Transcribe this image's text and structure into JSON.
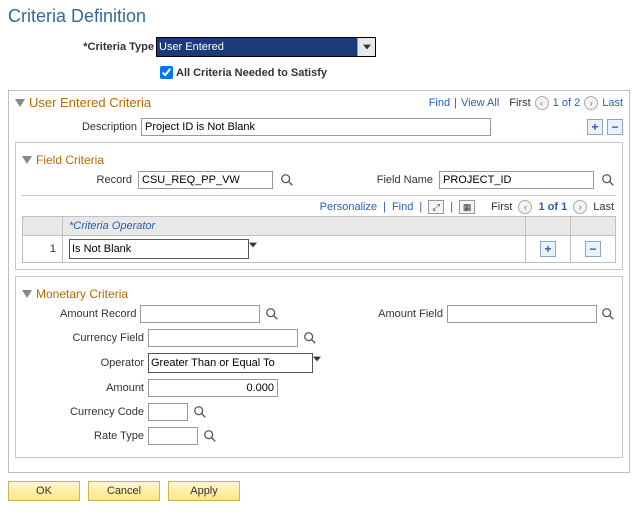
{
  "page_title": "Criteria Definition",
  "criteria_type": {
    "label": "*Criteria Type",
    "value": "User Entered"
  },
  "all_criteria_checkbox": {
    "label": "All Criteria Needed to Satisfy",
    "checked": true
  },
  "user_entered": {
    "title": "User Entered Criteria",
    "find": "Find",
    "view_all": "View All",
    "first_lbl": "First",
    "range": "1 of 2",
    "last_lbl": "Last",
    "description_label": "Description",
    "description_value": "Project ID is Not Blank"
  },
  "field_criteria": {
    "title": "Field Criteria",
    "record_label": "Record",
    "record_value": "CSU_REQ_PP_VW",
    "field_name_label": "Field Name",
    "field_name_value": "PROJECT_ID",
    "personalize": "Personalize",
    "find": "Find",
    "first_lbl": "First",
    "range": "1 of 1",
    "last_lbl": "Last",
    "col_operator": "*Criteria Operator",
    "rows": [
      {
        "idx": "1",
        "operator": "Is Not Blank"
      }
    ]
  },
  "monetary": {
    "title": "Monetary Criteria",
    "amount_record_label": "Amount Record",
    "amount_record_value": "",
    "amount_field_label": "Amount Field",
    "amount_field_value": "",
    "currency_field_label": "Currency Field",
    "currency_field_value": "",
    "operator_label": "Operator",
    "operator_value": "Greater Than or Equal To",
    "amount_label": "Amount",
    "amount_value": "0.000",
    "currency_code_label": "Currency Code",
    "currency_code_value": "",
    "rate_type_label": "Rate Type",
    "rate_type_value": ""
  },
  "buttons": {
    "ok": "OK",
    "cancel": "Cancel",
    "apply": "Apply"
  }
}
